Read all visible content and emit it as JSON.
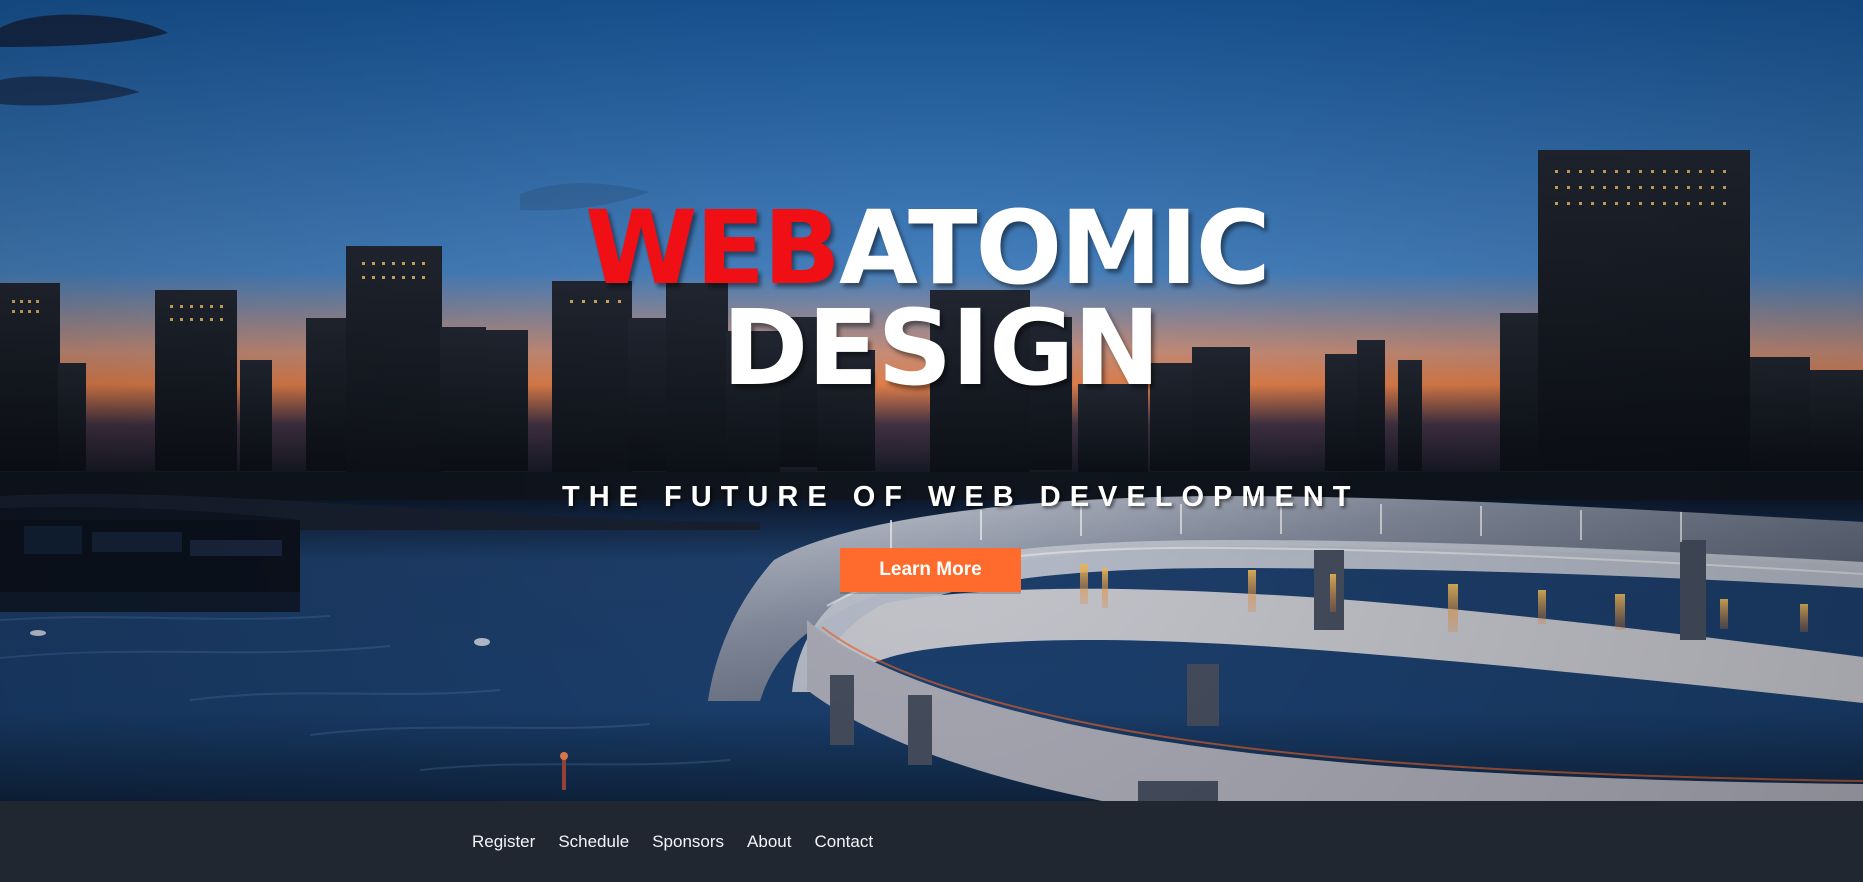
{
  "hero": {
    "title_part_1": "WEB",
    "title_part_2": "ATOMIC",
    "title_line_2": "DESIGN",
    "tagline": "THE FUTURE OF WEB DEVELOPMENT",
    "cta_label": "Learn More"
  },
  "footer": {
    "nav": [
      {
        "label": "Register"
      },
      {
        "label": "Schedule"
      },
      {
        "label": "Sponsors"
      },
      {
        "label": "About"
      },
      {
        "label": "Contact"
      }
    ]
  },
  "theme": {
    "accent_red": "#ef0f14",
    "cta_orange": "#ff6b2c",
    "footer_bg": "#212730",
    "text_white": "#ffffff"
  }
}
